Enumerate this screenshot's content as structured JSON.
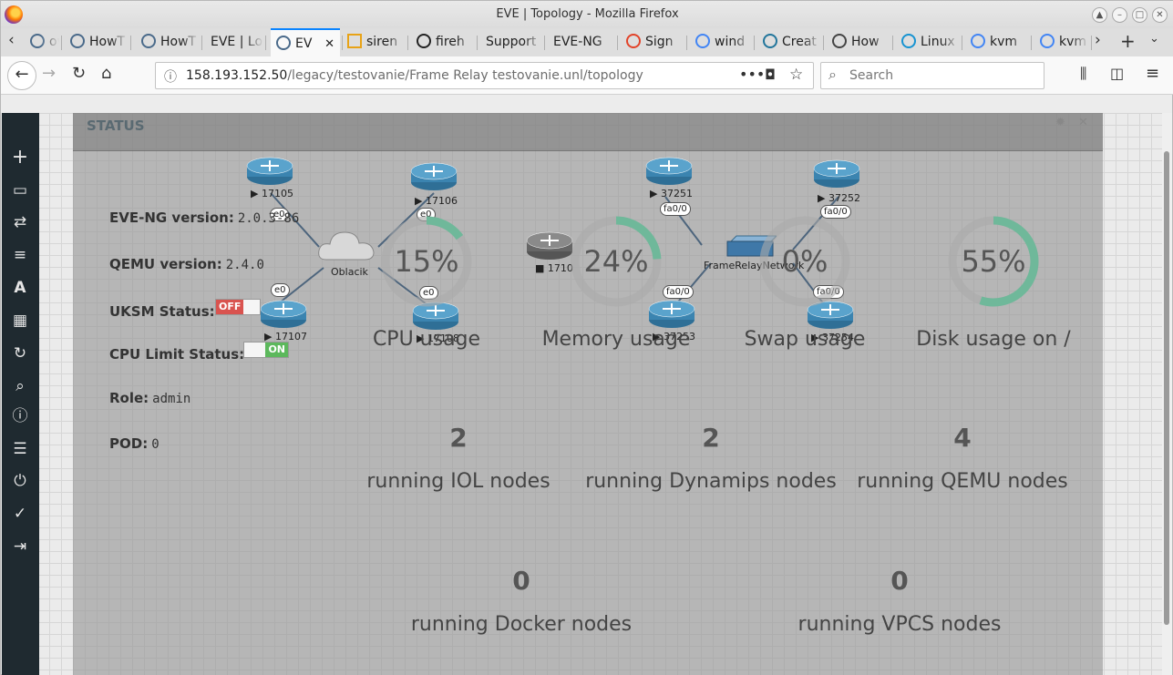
{
  "window": {
    "title": "EVE | Topology - Mozilla Firefox"
  },
  "tabs": [
    {
      "label": "ow",
      "icon": "eve-icon"
    },
    {
      "label": "HowT",
      "icon": "eve-icon"
    },
    {
      "label": "HowT",
      "icon": "eve-icon"
    },
    {
      "label": "EVE | Lo",
      "icon": ""
    },
    {
      "label": "EV",
      "icon": "eve-icon",
      "active": true
    },
    {
      "label": "siren",
      "icon": "warning-icon"
    },
    {
      "label": "fireh",
      "icon": "github-icon"
    },
    {
      "label": "Support",
      "icon": ""
    },
    {
      "label": "EVE-NG",
      "icon": ""
    },
    {
      "label": "Sign",
      "icon": "gitlab-icon"
    },
    {
      "label": "wind",
      "icon": "google-icon"
    },
    {
      "label": "Creat",
      "icon": "wordpress-icon"
    },
    {
      "label": "How",
      "icon": "site-icon"
    },
    {
      "label": "Linux",
      "icon": "arch-icon"
    },
    {
      "label": "kvm",
      "icon": "google-icon"
    },
    {
      "label": "kvm",
      "icon": "google-icon"
    }
  ],
  "navbar": {
    "url_host": "158.193.152.50",
    "url_path": "/legacy/testovanie/Frame Relay testovanie.unl/topology",
    "search_placeholder": "Search"
  },
  "sidebar": {
    "items": [
      "add-icon",
      "nodes-icon",
      "networks-icon",
      "startup-configs-icon",
      "text-icon",
      "topology-grid-icon",
      "refresh-icon",
      "zoom-icon",
      "info-icon",
      "lab-details-icon",
      "power-icon",
      "lock-icon",
      "logout-icon"
    ]
  },
  "status": {
    "title": "STATUS",
    "eve_version_label": "EVE-NG version:",
    "eve_version": "2.0.3-86",
    "qemu_version_label": "QEMU version:",
    "qemu_version": "2.4.0",
    "uksm_label": "UKSM Status:",
    "uksm_value": "OFF",
    "cpu_limit_label": "CPU Limit Status:",
    "cpu_limit_value": "ON",
    "role_label": "Role:",
    "role_value": "admin",
    "pod_label": "POD:",
    "pod_value": "0",
    "gauges": [
      {
        "value": "15%",
        "label": "CPU usage",
        "fraction": 0.15
      },
      {
        "value": "24%",
        "label": "Memory usage",
        "fraction": 0.24
      },
      {
        "value": "0%",
        "label": "Swap usage",
        "fraction": 0.0
      },
      {
        "value": "55%",
        "label": "Disk usage on /",
        "fraction": 0.55
      }
    ],
    "counts": [
      {
        "value": "2",
        "label": "running IOL nodes"
      },
      {
        "value": "2",
        "label": "running Dynamips nodes"
      },
      {
        "value": "4",
        "label": "running QEMU nodes"
      },
      {
        "value": "0",
        "label": "running Docker nodes"
      },
      {
        "value": "0",
        "label": "running VPCS nodes"
      }
    ]
  },
  "topology": {
    "nodes": [
      "17105",
      "17106",
      "17107",
      "17108",
      "1710",
      "37251",
      "37252",
      "37253",
      "37254"
    ],
    "cloud": "Oblacik",
    "switch": "FrameRelayNetwork",
    "interfaces": [
      "e0",
      "e0",
      "e0",
      "e0",
      "fa0/0",
      "fa0/0",
      "fa0/0",
      "fa0/0"
    ]
  }
}
